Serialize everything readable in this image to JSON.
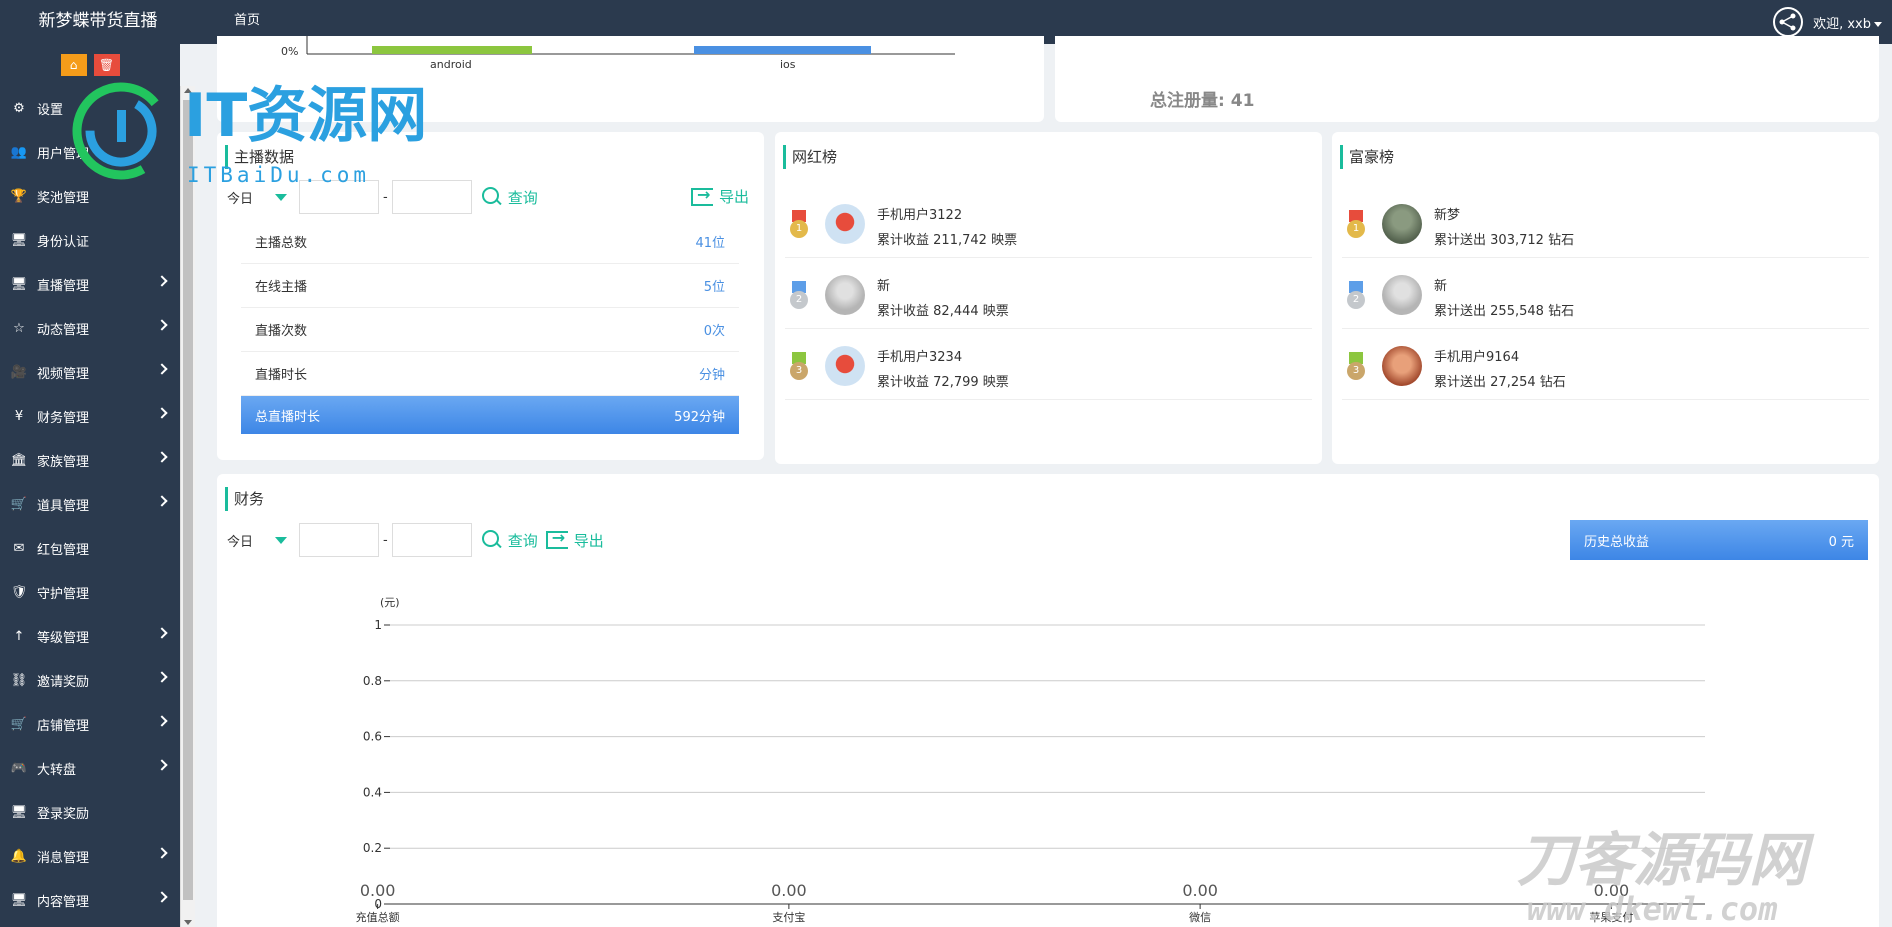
{
  "app": {
    "title": "新梦蝶带货直播"
  },
  "top_nav": {
    "home": "首页"
  },
  "user": {
    "greeting": "欢迎, xxb"
  },
  "sidebar": {
    "items": [
      {
        "label": "设置",
        "icon": "gears-icon",
        "arrow": false
      },
      {
        "label": "用户管理",
        "icon": "users-icon",
        "arrow": false
      },
      {
        "label": "奖池管理",
        "icon": "trophy-icon",
        "arrow": false
      },
      {
        "label": "身份认证",
        "icon": "monitor-icon",
        "arrow": false
      },
      {
        "label": "直播管理",
        "icon": "monitor-icon",
        "arrow": true
      },
      {
        "label": "动态管理",
        "icon": "star-icon",
        "arrow": true
      },
      {
        "label": "视频管理",
        "icon": "video-icon",
        "arrow": true
      },
      {
        "label": "财务管理",
        "icon": "yen-icon",
        "arrow": true
      },
      {
        "label": "家族管理",
        "icon": "bank-icon",
        "arrow": true
      },
      {
        "label": "道具管理",
        "icon": "cart-icon",
        "arrow": true
      },
      {
        "label": "红包管理",
        "icon": "envelope-icon",
        "arrow": false
      },
      {
        "label": "守护管理",
        "icon": "shield-icon",
        "arrow": false
      },
      {
        "label": "等级管理",
        "icon": "level-up-icon",
        "arrow": true
      },
      {
        "label": "邀请奖励",
        "icon": "sitemap-icon",
        "arrow": true
      },
      {
        "label": "店铺管理",
        "icon": "cart-icon",
        "arrow": true
      },
      {
        "label": "大转盘",
        "icon": "gamepad-icon",
        "arrow": true
      },
      {
        "label": "登录奖励",
        "icon": "monitor-icon",
        "arrow": false
      },
      {
        "label": "消息管理",
        "icon": "bell-icon",
        "arrow": true
      },
      {
        "label": "内容管理",
        "icon": "monitor-icon",
        "arrow": true
      }
    ]
  },
  "watermarks": {
    "it_main": "IT资源网",
    "it_sub": "ITBaiDu.com",
    "dk_main": "刀客源码网",
    "dk_sub": "www.dkewl.com"
  },
  "device_chart": {
    "y_tick": "0%",
    "categories": [
      "android",
      "ios"
    ]
  },
  "register": {
    "label": "总注册量:",
    "value": "41"
  },
  "anchor_stats": {
    "title": "主播数据",
    "filter": {
      "period": "今日",
      "separator": "-",
      "query": "查询",
      "export": "导出"
    },
    "rows": [
      {
        "label": "主播总数",
        "value": "41位"
      },
      {
        "label": "在线主播",
        "value": "5位"
      },
      {
        "label": "直播次数",
        "value": "0次"
      },
      {
        "label": "直播时长",
        "value": "分钟"
      },
      {
        "label": "总直播时长",
        "value": "592分钟"
      }
    ]
  },
  "influencer_rank": {
    "title": "网红榜",
    "items": [
      {
        "rank": "1",
        "name": "手机用户3122",
        "stat_label": "累计收益",
        "amount": "211,742",
        "unit": "映票"
      },
      {
        "rank": "2",
        "name": "新",
        "stat_label": "累计收益",
        "amount": "82,444",
        "unit": "映票"
      },
      {
        "rank": "3",
        "name": "手机用户3234",
        "stat_label": "累计收益",
        "amount": "72,799",
        "unit": "映票"
      }
    ]
  },
  "rich_rank": {
    "title": "富豪榜",
    "items": [
      {
        "rank": "1",
        "name": "新梦",
        "stat_label": "累计送出",
        "amount": "303,712",
        "unit": "钻石"
      },
      {
        "rank": "2",
        "name": "新",
        "stat_label": "累计送出",
        "amount": "255,548",
        "unit": "钻石"
      },
      {
        "rank": "3",
        "name": "手机用户9164",
        "stat_label": "累计送出",
        "amount": "27,254",
        "unit": "钻石"
      }
    ]
  },
  "finance": {
    "title": "财务",
    "filter": {
      "period": "今日",
      "separator": "-",
      "query": "查询",
      "export": "导出"
    },
    "history": {
      "label": "历史总收益",
      "value": "0 元"
    }
  },
  "chart_data": {
    "type": "bar",
    "ylabel": "(元)",
    "ylim": [
      0,
      1
    ],
    "y_ticks": [
      "0",
      "0.2",
      "0.4",
      "0.6",
      "0.8",
      "1"
    ],
    "grid": true,
    "categories": [
      "充值总额",
      "支付宝",
      "微信",
      "苹果支付"
    ],
    "values": [
      0,
      0,
      0,
      0
    ],
    "data_labels": [
      "0.00",
      "0.00",
      "0.00",
      "0.00"
    ]
  },
  "colors": {
    "sidebar": "#2b3a4e",
    "accent": "#1abc9c",
    "primary": "#4a90e2",
    "android": "#8cc63f",
    "ios": "#4a90e2"
  }
}
